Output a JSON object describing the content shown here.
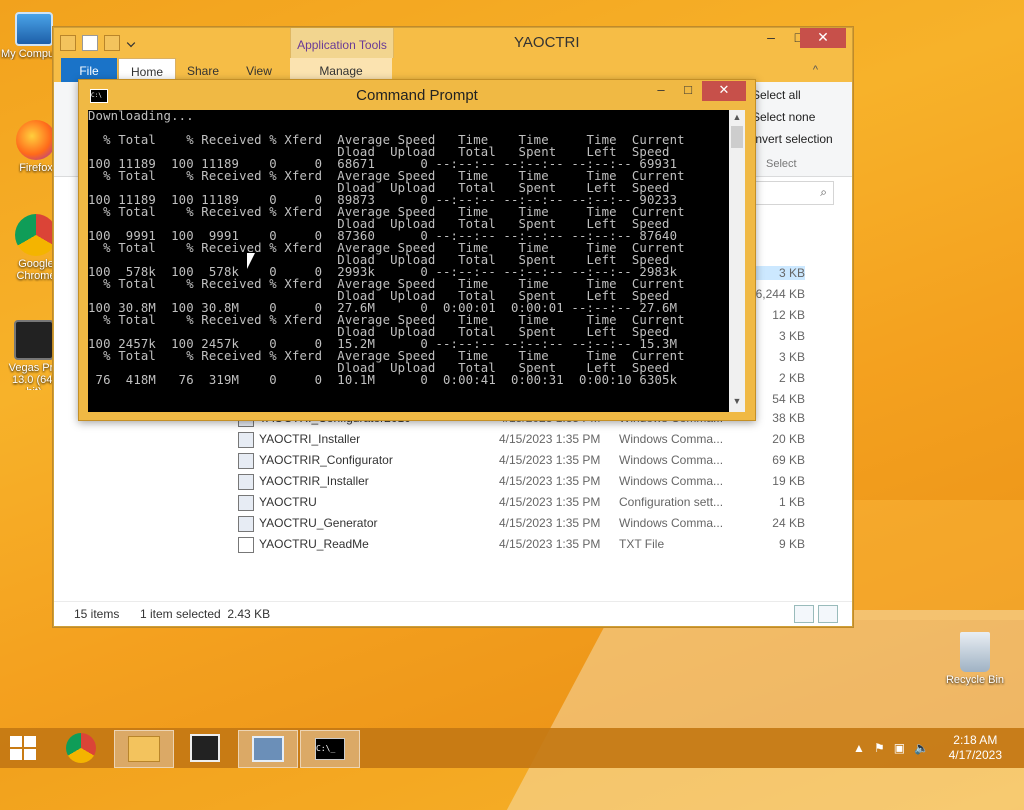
{
  "desktop": {
    "icons": [
      {
        "label": "My Computer"
      },
      {
        "label": "Firefox"
      },
      {
        "label": "Google Chrome"
      },
      {
        "label": "Vegas Pro 13.0 (64-bit)"
      },
      {
        "label": "Recycle Bin"
      }
    ]
  },
  "explorer": {
    "title": "YAOCTRI",
    "app_tools": "Application Tools",
    "tabs": {
      "file": "File",
      "home": "Home",
      "share": "Share",
      "view": "View",
      "manage": "Manage"
    },
    "select": {
      "all": "Select all",
      "none": "Select none",
      "invert": "Invert selection",
      "group": "Select"
    },
    "side_sizes": [
      "3 KB",
      "6,244 KB",
      "12 KB",
      "3 KB",
      "3 KB",
      "2 KB",
      "54 KB"
    ],
    "files": [
      {
        "name": "YAOCTRI_Configurator2010",
        "date": "4/15/2023 1:35 PM",
        "type": "Windows Comma...",
        "size": "38 KB"
      },
      {
        "name": "YAOCTRI_Installer",
        "date": "4/15/2023 1:35 PM",
        "type": "Windows Comma...",
        "size": "20 KB"
      },
      {
        "name": "YAOCTRIR_Configurator",
        "date": "4/15/2023 1:35 PM",
        "type": "Windows Comma...",
        "size": "69 KB"
      },
      {
        "name": "YAOCTRIR_Installer",
        "date": "4/15/2023 1:35 PM",
        "type": "Windows Comma...",
        "size": "19 KB"
      },
      {
        "name": "YAOCTRU",
        "date": "4/15/2023 1:35 PM",
        "type": "Configuration sett...",
        "size": "1 KB"
      },
      {
        "name": "YAOCTRU_Generator",
        "date": "4/15/2023 1:35 PM",
        "type": "Windows Comma...",
        "size": "24 KB"
      },
      {
        "name": "YAOCTRU_ReadMe",
        "date": "4/15/2023 1:35 PM",
        "type": "TXT File",
        "size": "9 KB"
      }
    ],
    "status": {
      "items": "15 items",
      "selected": "1 item selected  2.43 KB"
    }
  },
  "cmd": {
    "title": "Command Prompt",
    "output": "Downloading...\n\n  % Total    % Received % Xferd  Average Speed   Time    Time     Time  Current\n                                 Dload  Upload   Total   Spent    Left  Speed\n100 11189  100 11189    0     0  68671      0 --:--:-- --:--:-- --:--:-- 69931\n  % Total    % Received % Xferd  Average Speed   Time    Time     Time  Current\n                                 Dload  Upload   Total   Spent    Left  Speed\n100 11189  100 11189    0     0  89873      0 --:--:-- --:--:-- --:--:-- 90233\n  % Total    % Received % Xferd  Average Speed   Time    Time     Time  Current\n                                 Dload  Upload   Total   Spent    Left  Speed\n100  9991  100  9991    0     0  87360      0 --:--:-- --:--:-- --:--:-- 87640\n  % Total    % Received % Xferd  Average Speed   Time    Time     Time  Current\n                                 Dload  Upload   Total   Spent    Left  Speed\n100  578k  100  578k    0     0  2993k      0 --:--:-- --:--:-- --:--:-- 2983k\n  % Total    % Received % Xferd  Average Speed   Time    Time     Time  Current\n                                 Dload  Upload   Total   Spent    Left  Speed\n100 30.8M  100 30.8M    0     0  27.6M      0  0:00:01  0:00:01 --:--:-- 27.6M\n  % Total    % Received % Xferd  Average Speed   Time    Time     Time  Current\n                                 Dload  Upload   Total   Spent    Left  Speed\n100 2457k  100 2457k    0     0  15.2M      0 --:--:-- --:--:-- --:--:-- 15.3M\n  % Total    % Received % Xferd  Average Speed   Time    Time     Time  Current\n                                 Dload  Upload   Total   Spent    Left  Speed\n 76  418M   76  319M    0     0  10.1M      0  0:00:41  0:00:31  0:00:10 6305k"
  },
  "taskbar": {
    "time": "2:18 AM",
    "date": "4/17/2023"
  },
  "colors": {
    "accent": "#1a73c8",
    "title_bar": "#f6bd46",
    "close": "#c7504a"
  }
}
